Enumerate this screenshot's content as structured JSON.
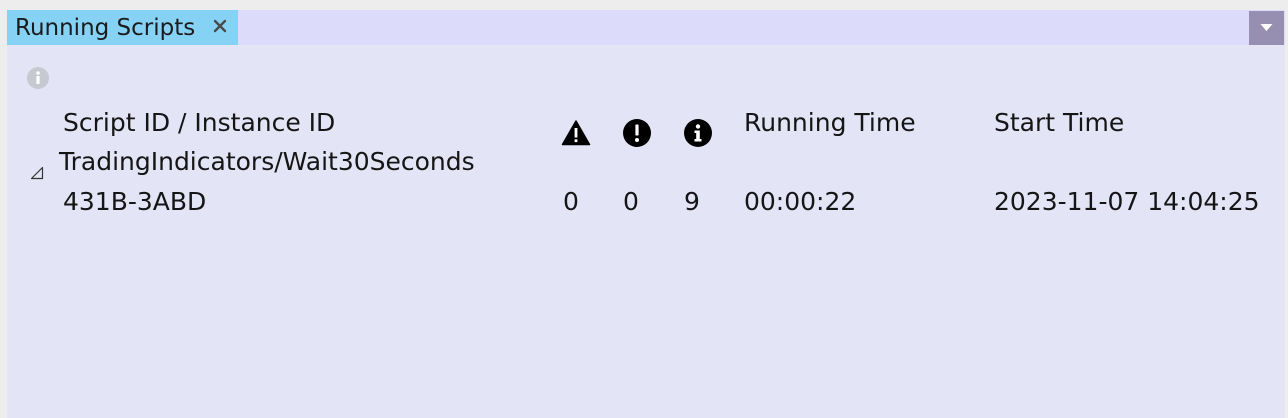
{
  "tab": {
    "title": "Running Scripts",
    "close_icon": "close-icon"
  },
  "toolbar": {
    "menu_icon": "chevron-down-icon",
    "info_icon": "info-icon"
  },
  "colors": {
    "tab_active": "#86d2f5",
    "tab_bar": "#dcdcfa",
    "panel_background": "#e3e4f6",
    "menu_button": "#968fb1"
  },
  "table": {
    "columns": [
      {
        "key": "id",
        "label": "Script ID / Instance ID"
      },
      {
        "key": "warnings",
        "icon": "warning-icon"
      },
      {
        "key": "errors",
        "icon": "error-icon"
      },
      {
        "key": "infos",
        "icon": "info-icon"
      },
      {
        "key": "running_time",
        "label": "Running Time"
      },
      {
        "key": "start_time",
        "label": "Start Time"
      }
    ],
    "groups": [
      {
        "script_id": "TradingIndicators/Wait30Seconds",
        "expanded": true,
        "instances": [
          {
            "instance_id": "431B-3ABD",
            "warnings": "0",
            "errors": "0",
            "infos": "9",
            "running_time": "00:00:22",
            "start_time": "2023-11-07 14:04:25"
          }
        ]
      }
    ]
  }
}
